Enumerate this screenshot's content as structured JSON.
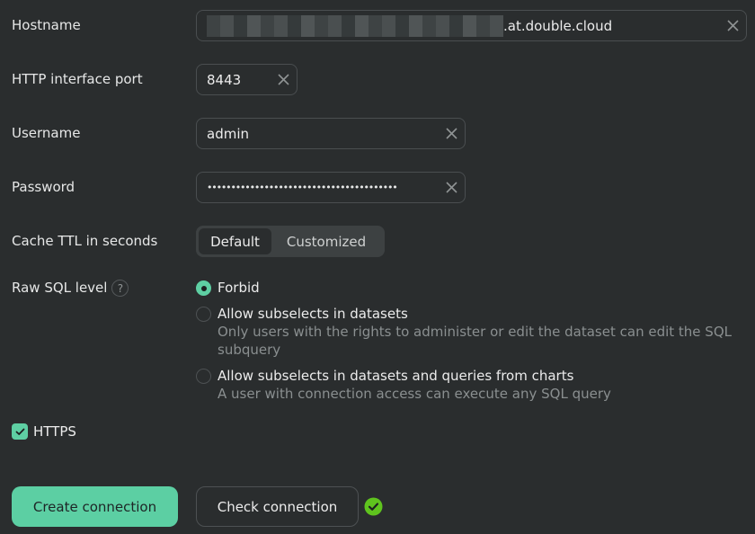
{
  "form": {
    "hostname": {
      "label": "Hostname",
      "value_suffix": ".at.double.cloud",
      "value_obscured": true
    },
    "port": {
      "label": "HTTP interface port",
      "value": "8443"
    },
    "username": {
      "label": "Username",
      "value": "admin"
    },
    "password": {
      "label": "Password",
      "value": "••••••••••••••••••••••••••••••••••••••••"
    },
    "cache_ttl": {
      "label": "Cache TTL in seconds",
      "options": [
        "Default",
        "Customized"
      ],
      "selected": "Default"
    },
    "raw_sql": {
      "label": "Raw SQL level",
      "help": "?",
      "selected": "Forbid",
      "options": [
        {
          "title": "Forbid",
          "description": ""
        },
        {
          "title": "Allow subselects in datasets",
          "description": "Only users with the rights to administer or edit the dataset can edit the SQL subquery"
        },
        {
          "title": "Allow subselects in datasets and queries from charts",
          "description": "A user with connection access can execute any SQL query"
        }
      ]
    },
    "https": {
      "label": "HTTPS",
      "checked": true
    }
  },
  "actions": {
    "create_label": "Create connection",
    "check_label": "Check connection",
    "check_status": "success"
  },
  "colors": {
    "accent": "#5ecfa3",
    "success": "#5fc31e",
    "background": "#2a2d2e"
  }
}
